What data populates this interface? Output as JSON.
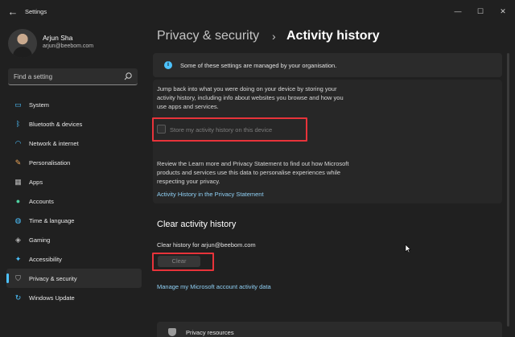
{
  "window": {
    "title": "Settings",
    "back_icon": "back-arrow-icon",
    "controls": [
      "minimize-icon",
      "maximize-icon",
      "close-icon"
    ]
  },
  "user": {
    "name": "Arjun Sha",
    "email": "arjun@beebom.com"
  },
  "search": {
    "placeholder": "Find a setting"
  },
  "sidebar": {
    "items": [
      {
        "label": "System",
        "icon": "monitor-icon",
        "color": "#4cc2ff"
      },
      {
        "label": "Bluetooth & devices",
        "icon": "bluetooth-icon",
        "color": "#4cc2ff"
      },
      {
        "label": "Network & internet",
        "icon": "wifi-icon",
        "color": "#4cc2ff"
      },
      {
        "label": "Personalisation",
        "icon": "brush-icon",
        "color": "#f0a85a"
      },
      {
        "label": "Apps",
        "icon": "apps-icon",
        "color": "#b8b8b8"
      },
      {
        "label": "Accounts",
        "icon": "person-icon",
        "color": "#4fd1a1"
      },
      {
        "label": "Time & language",
        "icon": "globe-clock-icon",
        "color": "#4cc2ff"
      },
      {
        "label": "Gaming",
        "icon": "gamepad-icon",
        "color": "#b8b8b8"
      },
      {
        "label": "Accessibility",
        "icon": "accessibility-icon",
        "color": "#4cc2ff"
      },
      {
        "label": "Privacy & security",
        "icon": "shield-icon",
        "color": "#b8b8b8",
        "active": true
      },
      {
        "label": "Windows Update",
        "icon": "update-icon",
        "color": "#4cc2ff"
      }
    ]
  },
  "breadcrumb": {
    "parent": "Privacy & security",
    "separator": "›",
    "current": "Activity history"
  },
  "info_banner": {
    "text": "Some of these settings are managed by your organisation."
  },
  "activity": {
    "description_lines": [
      "Jump back into what you were doing on your device by storing your",
      "activity history, including info about websites you browse and how you",
      "use apps and services."
    ],
    "store_checkbox_label": "Store my activity history on this device",
    "store_checkbox_checked": false,
    "review_lines": [
      "Review the Learn more and Privacy Statement to find out how Microsoft",
      "products and services use this data to personalise experiences while",
      "respecting your privacy."
    ],
    "privacy_link": "Activity History in the Privacy Statement"
  },
  "clear_section": {
    "title": "Clear activity history",
    "clear_for": "Clear history for arjun@beebom.com",
    "clear_button": "Clear",
    "manage_link": "Manage my Microsoft account activity data"
  },
  "bottom_card": {
    "label": "Privacy resources"
  },
  "colors": {
    "accent": "#4cc2ff",
    "highlight": "#e8333a",
    "link": "#8fd0f5",
    "background": "#202020"
  }
}
